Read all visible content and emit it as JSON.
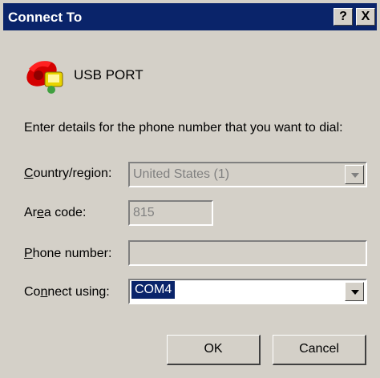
{
  "window": {
    "title": "Connect To",
    "help_button": "?",
    "close_button": "X"
  },
  "header": {
    "icon": "phone-icon",
    "label": "USB PORT"
  },
  "prompt": "Enter details for the phone number that you want to dial:",
  "fields": {
    "country": {
      "label_pre": "",
      "label_accel": "C",
      "label_post": "ountry/region:",
      "value": "United States (1)"
    },
    "area_code": {
      "label_pre": "Ar",
      "label_accel": "e",
      "label_post": "a code:",
      "value": "815"
    },
    "phone_number": {
      "label_pre": "",
      "label_accel": "P",
      "label_post": "hone number:",
      "value": ""
    },
    "connect_using": {
      "label_pre": "Co",
      "label_accel": "n",
      "label_post": "nect using:",
      "value": "COM4"
    }
  },
  "buttons": {
    "ok": "OK",
    "cancel": "Cancel"
  }
}
